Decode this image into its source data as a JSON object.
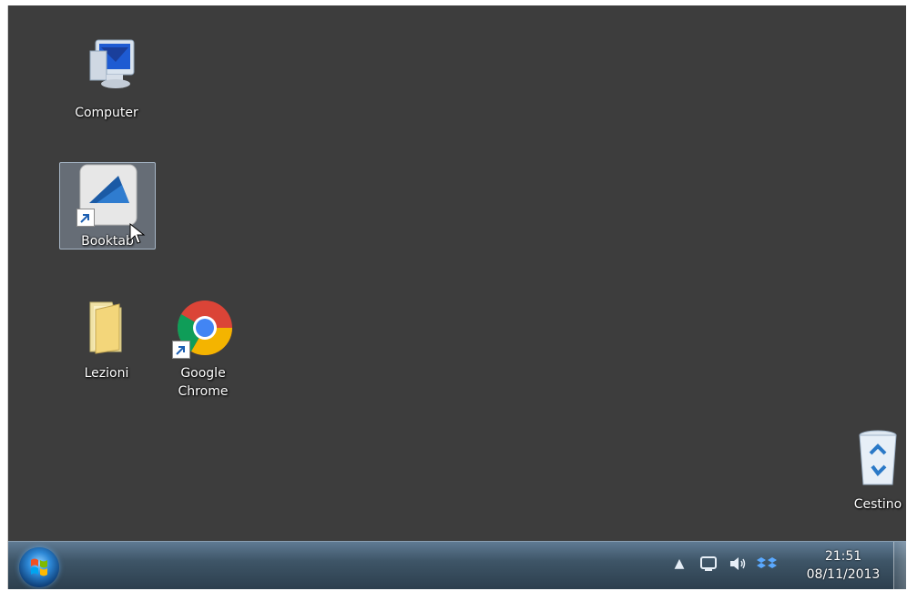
{
  "desktop": {
    "icons": [
      {
        "label": "Computer",
        "icon": "computer-icon",
        "selected": false
      },
      {
        "label": "Booktab",
        "icon": "booktab-icon",
        "selected": true
      },
      {
        "label": "Lezioni",
        "icon": "folder-icon",
        "selected": false
      },
      {
        "label": "Google Chrome",
        "icon": "chrome-icon",
        "selected": false
      },
      {
        "label": "Cestino",
        "icon": "recycle-bin-icon",
        "selected": false
      }
    ]
  },
  "taskbar": {
    "start_icon": "windows-start-icon",
    "tray": [
      {
        "icon": "show-hidden-icons-arrow",
        "glyph": "▲"
      },
      {
        "icon": "network-icon"
      },
      {
        "icon": "volume-icon"
      },
      {
        "icon": "dropbox-icon"
      }
    ],
    "clock_time": "21:51",
    "clock_date": "08/11/2013"
  },
  "colors": {
    "desktop_background": "#3d3d3d",
    "taskbar": "#3e5567",
    "selection": "#b4c8e1"
  }
}
